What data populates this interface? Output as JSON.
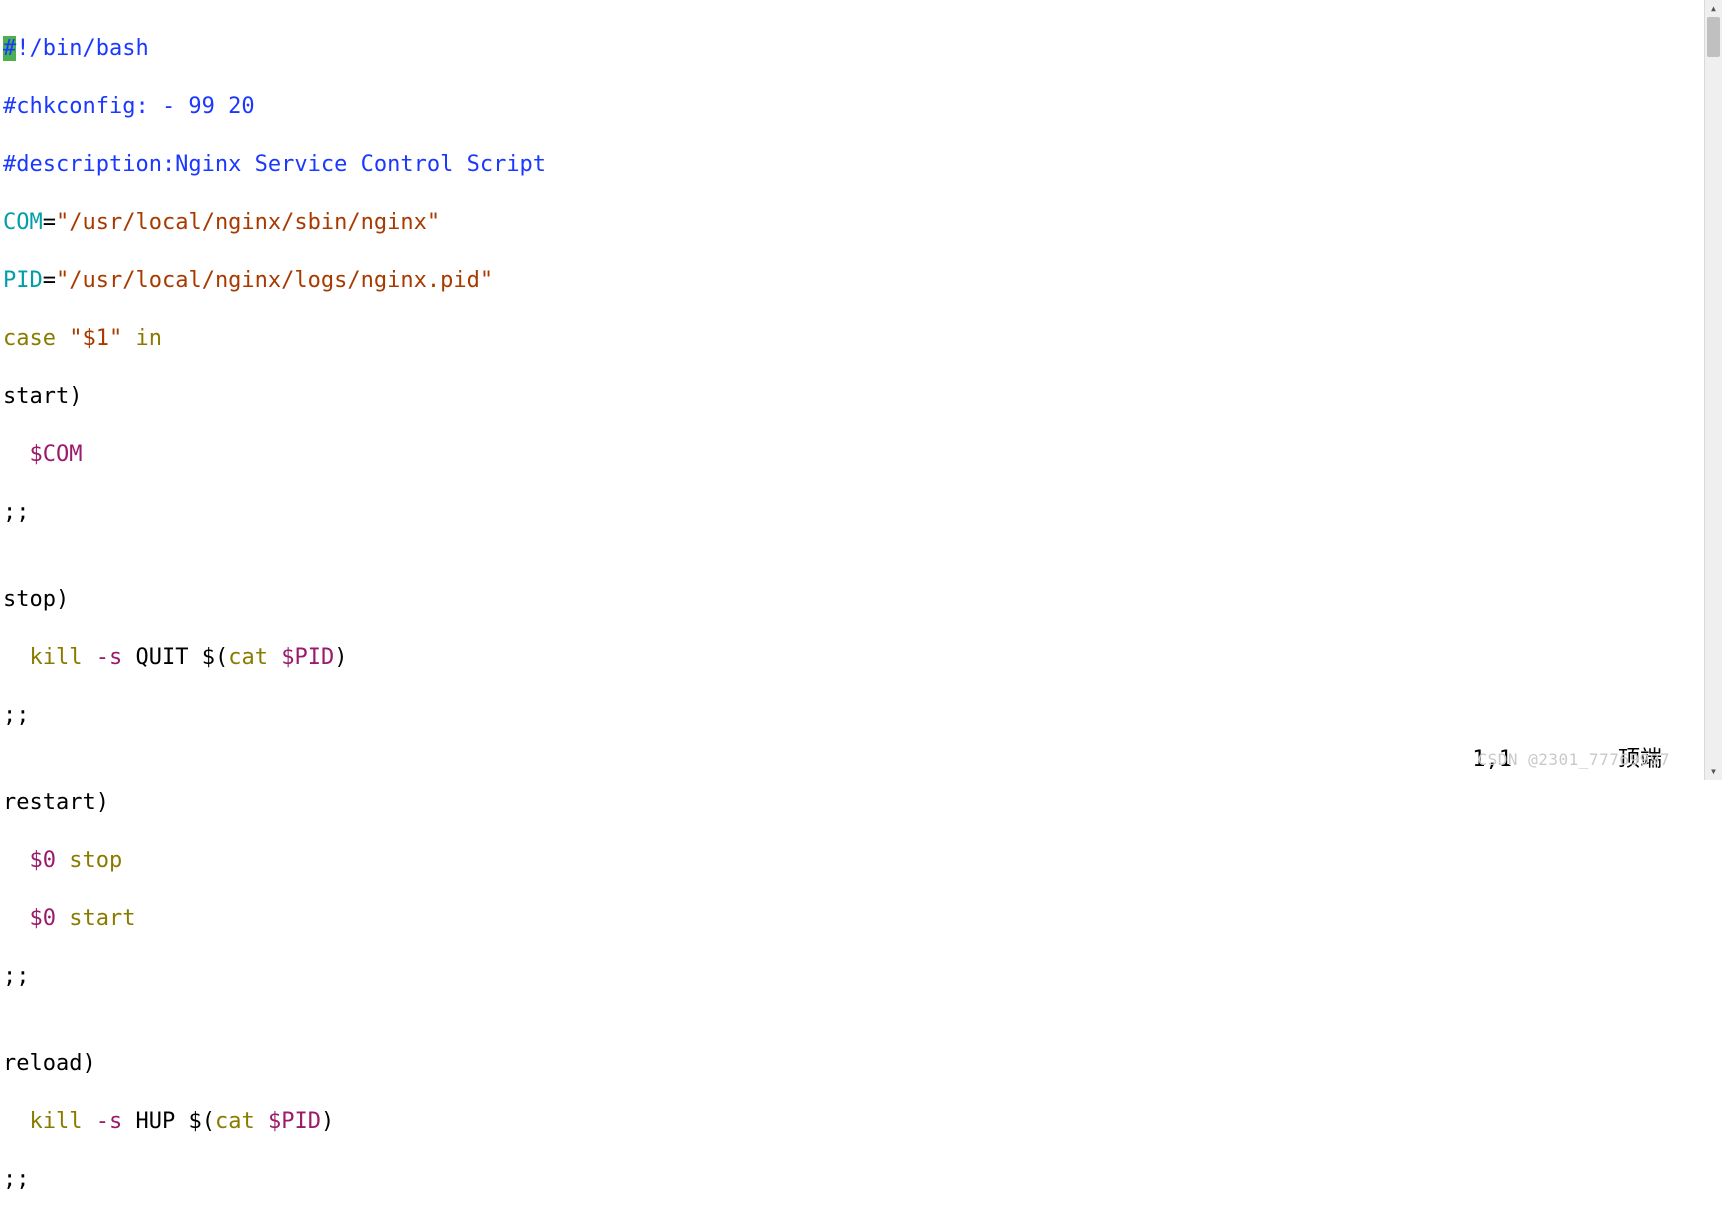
{
  "code": {
    "l1a": "#",
    "l1b": "!/bin/bash",
    "l2": "#chkconfig: - 99 20",
    "l3": "#description:Nginx Service Control Script",
    "l4_var": "COM",
    "l4_eq": "=",
    "l4_str": "\"/usr/local/nginx/sbin/nginx\"",
    "l5_var": "PID",
    "l5_eq": "=",
    "l5_str": "\"/usr/local/nginx/logs/nginx.pid\"",
    "l6_case": "case",
    "l6_sp1": " ",
    "l6_str": "\"$1\"",
    "l6_sp2": " ",
    "l6_in": "in",
    "l7_lbl": "start",
    "l7_p": ")",
    "l8_ind": "  ",
    "l8_var": "$COM",
    "l9": ";;",
    "l10": "",
    "l11_lbl": "stop",
    "l11_p": ")",
    "l12_ind": "  ",
    "l12_a": "kill ",
    "l12_b": "-s",
    "l12_c": " QUIT $(",
    "l12_d": "cat",
    "l12_e": " ",
    "l12_f": "$PID",
    "l12_g": ")",
    "l13": ";;",
    "l14": "",
    "l15_lbl": "restart",
    "l15_p": ")",
    "l16_ind": "  ",
    "l16_a": "$0",
    "l16_b": " ",
    "l16_c": "stop",
    "l17_ind": "  ",
    "l17_a": "$0",
    "l17_b": " ",
    "l17_c": "start",
    "l18": ";;",
    "l19": "",
    "l20_lbl": "reload",
    "l20_p": ")",
    "l21_ind": "  ",
    "l21_a": "kill ",
    "l21_b": "-s",
    "l21_c": " HUP $(",
    "l21_d": "cat",
    "l21_e": " ",
    "l21_f": "$PID",
    "l21_g": ")",
    "l22": ";;"
  },
  "status": {
    "pos": "1,1",
    "right": "顶端"
  },
  "watermark": "CSDN @2301_77769997",
  "scroll": {
    "up": "▴",
    "down": "▾"
  }
}
